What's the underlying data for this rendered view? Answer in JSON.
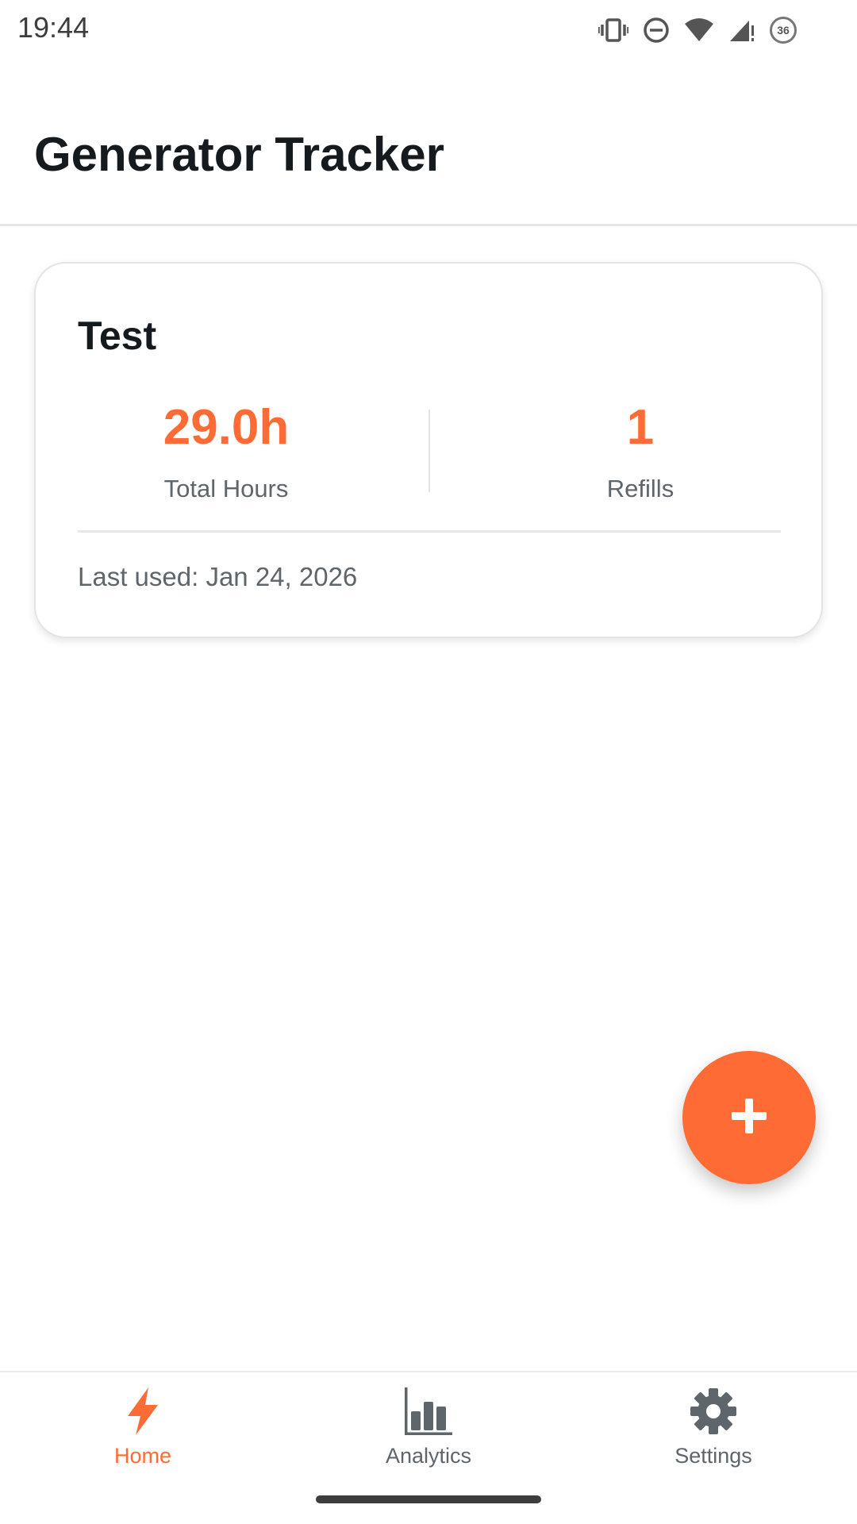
{
  "status_bar": {
    "time": "19:44",
    "icons": [
      "vibrate-icon",
      "do-not-disturb-icon",
      "wifi-icon",
      "signal-icon",
      "battery-icon"
    ],
    "battery_level": "36"
  },
  "app_bar": {
    "title": "Generator Tracker"
  },
  "generator_card": {
    "name": "Test",
    "total_hours_value": "29.0h",
    "total_hours_label": "Total Hours",
    "refills_value": "1",
    "refills_label": "Refills",
    "last_used": "Last used: Jan 24, 2026"
  },
  "fab": {
    "icon": "plus-icon"
  },
  "bottom_nav": {
    "items": [
      {
        "label": "Home",
        "icon": "lightning-icon",
        "active": true
      },
      {
        "label": "Analytics",
        "icon": "bar-chart-icon",
        "active": false
      },
      {
        "label": "Settings",
        "icon": "gear-icon",
        "active": false
      }
    ]
  },
  "colors": {
    "accent": "#ff6b35",
    "text_primary": "#151a1e",
    "text_secondary": "#5e656b"
  }
}
